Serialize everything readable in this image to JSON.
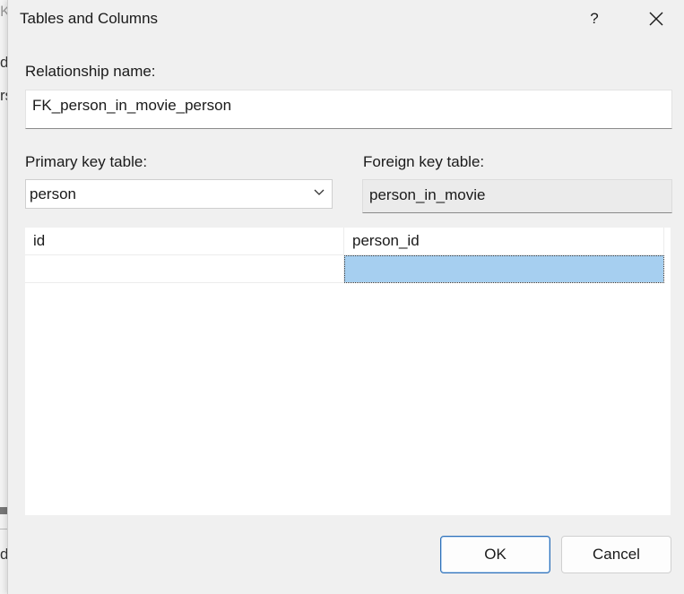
{
  "background_window": {
    "fragments": [
      "K",
      "d",
      "rs",
      "d"
    ]
  },
  "dialog": {
    "title": "Tables and Columns",
    "help_label": "?",
    "relationship_name_label": "Relationship name:",
    "relationship_name_value": "FK_person_in_movie_person",
    "primary_key_table_label": "Primary key table:",
    "primary_key_table_value": "person",
    "foreign_key_table_label": "Foreign key table:",
    "foreign_key_table_value": "person_in_movie",
    "columns_grid": {
      "rows": [
        [
          "id",
          "person_id"
        ],
        [
          "",
          ""
        ]
      ],
      "selected_cell": "row 2, column 2"
    },
    "ok_label": "OK",
    "cancel_label": "Cancel"
  },
  "colors": {
    "dialog_background": "#f0f0f0",
    "selection": "#a6cff0",
    "default_button_border": "#2c6fb8"
  }
}
